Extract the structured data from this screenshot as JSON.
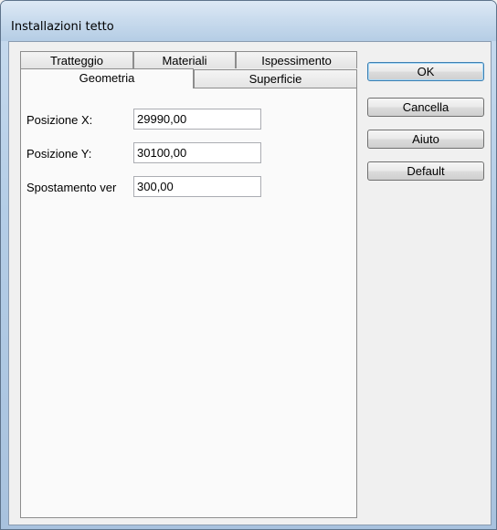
{
  "window": {
    "title": "Installazioni tetto"
  },
  "tabs": {
    "back_row": [
      {
        "label": "Tratteggio"
      },
      {
        "label": "Materiali"
      },
      {
        "label": "Ispessimento"
      }
    ],
    "front_row": [
      {
        "label": "Geometria",
        "active": true
      },
      {
        "label": "Superficie",
        "active": false
      }
    ]
  },
  "geometry": {
    "pos_x": {
      "label": "Posizione X:",
      "value": "29990,00"
    },
    "pos_y": {
      "label": "Posizione Y:",
      "value": "30100,00"
    },
    "offset": {
      "label": "Spostamento ver",
      "value": "300,00"
    }
  },
  "buttons": {
    "ok": "OK",
    "cancel": "Cancella",
    "help": "Aiuto",
    "default": "Default"
  }
}
